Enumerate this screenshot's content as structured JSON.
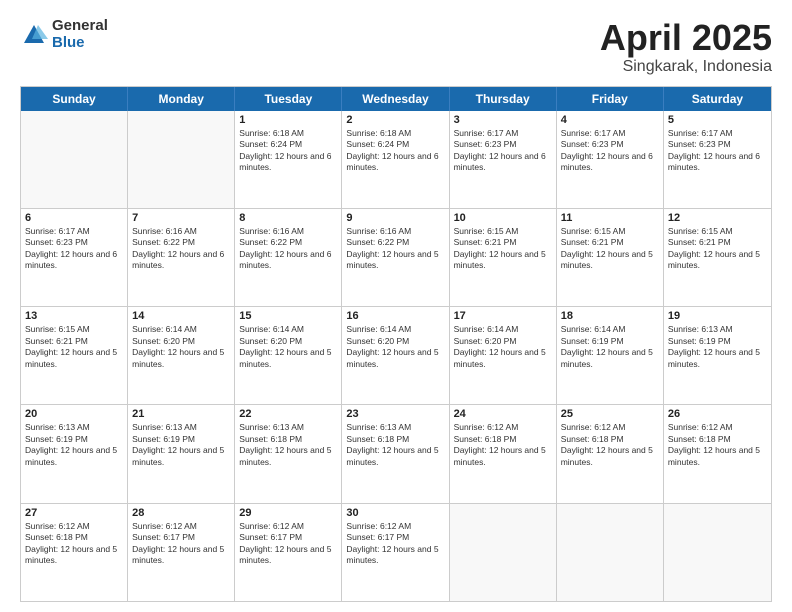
{
  "logo": {
    "general": "General",
    "blue": "Blue"
  },
  "title": {
    "month": "April 2025",
    "location": "Singkarak, Indonesia"
  },
  "header": {
    "days": [
      "Sunday",
      "Monday",
      "Tuesday",
      "Wednesday",
      "Thursday",
      "Friday",
      "Saturday"
    ]
  },
  "weeks": [
    [
      {
        "day": "",
        "sunrise": "",
        "sunset": "",
        "daylight": ""
      },
      {
        "day": "",
        "sunrise": "",
        "sunset": "",
        "daylight": ""
      },
      {
        "day": "1",
        "sunrise": "Sunrise: 6:18 AM",
        "sunset": "Sunset: 6:24 PM",
        "daylight": "Daylight: 12 hours and 6 minutes."
      },
      {
        "day": "2",
        "sunrise": "Sunrise: 6:18 AM",
        "sunset": "Sunset: 6:24 PM",
        "daylight": "Daylight: 12 hours and 6 minutes."
      },
      {
        "day": "3",
        "sunrise": "Sunrise: 6:17 AM",
        "sunset": "Sunset: 6:23 PM",
        "daylight": "Daylight: 12 hours and 6 minutes."
      },
      {
        "day": "4",
        "sunrise": "Sunrise: 6:17 AM",
        "sunset": "Sunset: 6:23 PM",
        "daylight": "Daylight: 12 hours and 6 minutes."
      },
      {
        "day": "5",
        "sunrise": "Sunrise: 6:17 AM",
        "sunset": "Sunset: 6:23 PM",
        "daylight": "Daylight: 12 hours and 6 minutes."
      }
    ],
    [
      {
        "day": "6",
        "sunrise": "Sunrise: 6:17 AM",
        "sunset": "Sunset: 6:23 PM",
        "daylight": "Daylight: 12 hours and 6 minutes."
      },
      {
        "day": "7",
        "sunrise": "Sunrise: 6:16 AM",
        "sunset": "Sunset: 6:22 PM",
        "daylight": "Daylight: 12 hours and 6 minutes."
      },
      {
        "day": "8",
        "sunrise": "Sunrise: 6:16 AM",
        "sunset": "Sunset: 6:22 PM",
        "daylight": "Daylight: 12 hours and 6 minutes."
      },
      {
        "day": "9",
        "sunrise": "Sunrise: 6:16 AM",
        "sunset": "Sunset: 6:22 PM",
        "daylight": "Daylight: 12 hours and 5 minutes."
      },
      {
        "day": "10",
        "sunrise": "Sunrise: 6:15 AM",
        "sunset": "Sunset: 6:21 PM",
        "daylight": "Daylight: 12 hours and 5 minutes."
      },
      {
        "day": "11",
        "sunrise": "Sunrise: 6:15 AM",
        "sunset": "Sunset: 6:21 PM",
        "daylight": "Daylight: 12 hours and 5 minutes."
      },
      {
        "day": "12",
        "sunrise": "Sunrise: 6:15 AM",
        "sunset": "Sunset: 6:21 PM",
        "daylight": "Daylight: 12 hours and 5 minutes."
      }
    ],
    [
      {
        "day": "13",
        "sunrise": "Sunrise: 6:15 AM",
        "sunset": "Sunset: 6:21 PM",
        "daylight": "Daylight: 12 hours and 5 minutes."
      },
      {
        "day": "14",
        "sunrise": "Sunrise: 6:14 AM",
        "sunset": "Sunset: 6:20 PM",
        "daylight": "Daylight: 12 hours and 5 minutes."
      },
      {
        "day": "15",
        "sunrise": "Sunrise: 6:14 AM",
        "sunset": "Sunset: 6:20 PM",
        "daylight": "Daylight: 12 hours and 5 minutes."
      },
      {
        "day": "16",
        "sunrise": "Sunrise: 6:14 AM",
        "sunset": "Sunset: 6:20 PM",
        "daylight": "Daylight: 12 hours and 5 minutes."
      },
      {
        "day": "17",
        "sunrise": "Sunrise: 6:14 AM",
        "sunset": "Sunset: 6:20 PM",
        "daylight": "Daylight: 12 hours and 5 minutes."
      },
      {
        "day": "18",
        "sunrise": "Sunrise: 6:14 AM",
        "sunset": "Sunset: 6:19 PM",
        "daylight": "Daylight: 12 hours and 5 minutes."
      },
      {
        "day": "19",
        "sunrise": "Sunrise: 6:13 AM",
        "sunset": "Sunset: 6:19 PM",
        "daylight": "Daylight: 12 hours and 5 minutes."
      }
    ],
    [
      {
        "day": "20",
        "sunrise": "Sunrise: 6:13 AM",
        "sunset": "Sunset: 6:19 PM",
        "daylight": "Daylight: 12 hours and 5 minutes."
      },
      {
        "day": "21",
        "sunrise": "Sunrise: 6:13 AM",
        "sunset": "Sunset: 6:19 PM",
        "daylight": "Daylight: 12 hours and 5 minutes."
      },
      {
        "day": "22",
        "sunrise": "Sunrise: 6:13 AM",
        "sunset": "Sunset: 6:18 PM",
        "daylight": "Daylight: 12 hours and 5 minutes."
      },
      {
        "day": "23",
        "sunrise": "Sunrise: 6:13 AM",
        "sunset": "Sunset: 6:18 PM",
        "daylight": "Daylight: 12 hours and 5 minutes."
      },
      {
        "day": "24",
        "sunrise": "Sunrise: 6:12 AM",
        "sunset": "Sunset: 6:18 PM",
        "daylight": "Daylight: 12 hours and 5 minutes."
      },
      {
        "day": "25",
        "sunrise": "Sunrise: 6:12 AM",
        "sunset": "Sunset: 6:18 PM",
        "daylight": "Daylight: 12 hours and 5 minutes."
      },
      {
        "day": "26",
        "sunrise": "Sunrise: 6:12 AM",
        "sunset": "Sunset: 6:18 PM",
        "daylight": "Daylight: 12 hours and 5 minutes."
      }
    ],
    [
      {
        "day": "27",
        "sunrise": "Sunrise: 6:12 AM",
        "sunset": "Sunset: 6:18 PM",
        "daylight": "Daylight: 12 hours and 5 minutes."
      },
      {
        "day": "28",
        "sunrise": "Sunrise: 6:12 AM",
        "sunset": "Sunset: 6:17 PM",
        "daylight": "Daylight: 12 hours and 5 minutes."
      },
      {
        "day": "29",
        "sunrise": "Sunrise: 6:12 AM",
        "sunset": "Sunset: 6:17 PM",
        "daylight": "Daylight: 12 hours and 5 minutes."
      },
      {
        "day": "30",
        "sunrise": "Sunrise: 6:12 AM",
        "sunset": "Sunset: 6:17 PM",
        "daylight": "Daylight: 12 hours and 5 minutes."
      },
      {
        "day": "",
        "sunrise": "",
        "sunset": "",
        "daylight": ""
      },
      {
        "day": "",
        "sunrise": "",
        "sunset": "",
        "daylight": ""
      },
      {
        "day": "",
        "sunrise": "",
        "sunset": "",
        "daylight": ""
      }
    ]
  ]
}
